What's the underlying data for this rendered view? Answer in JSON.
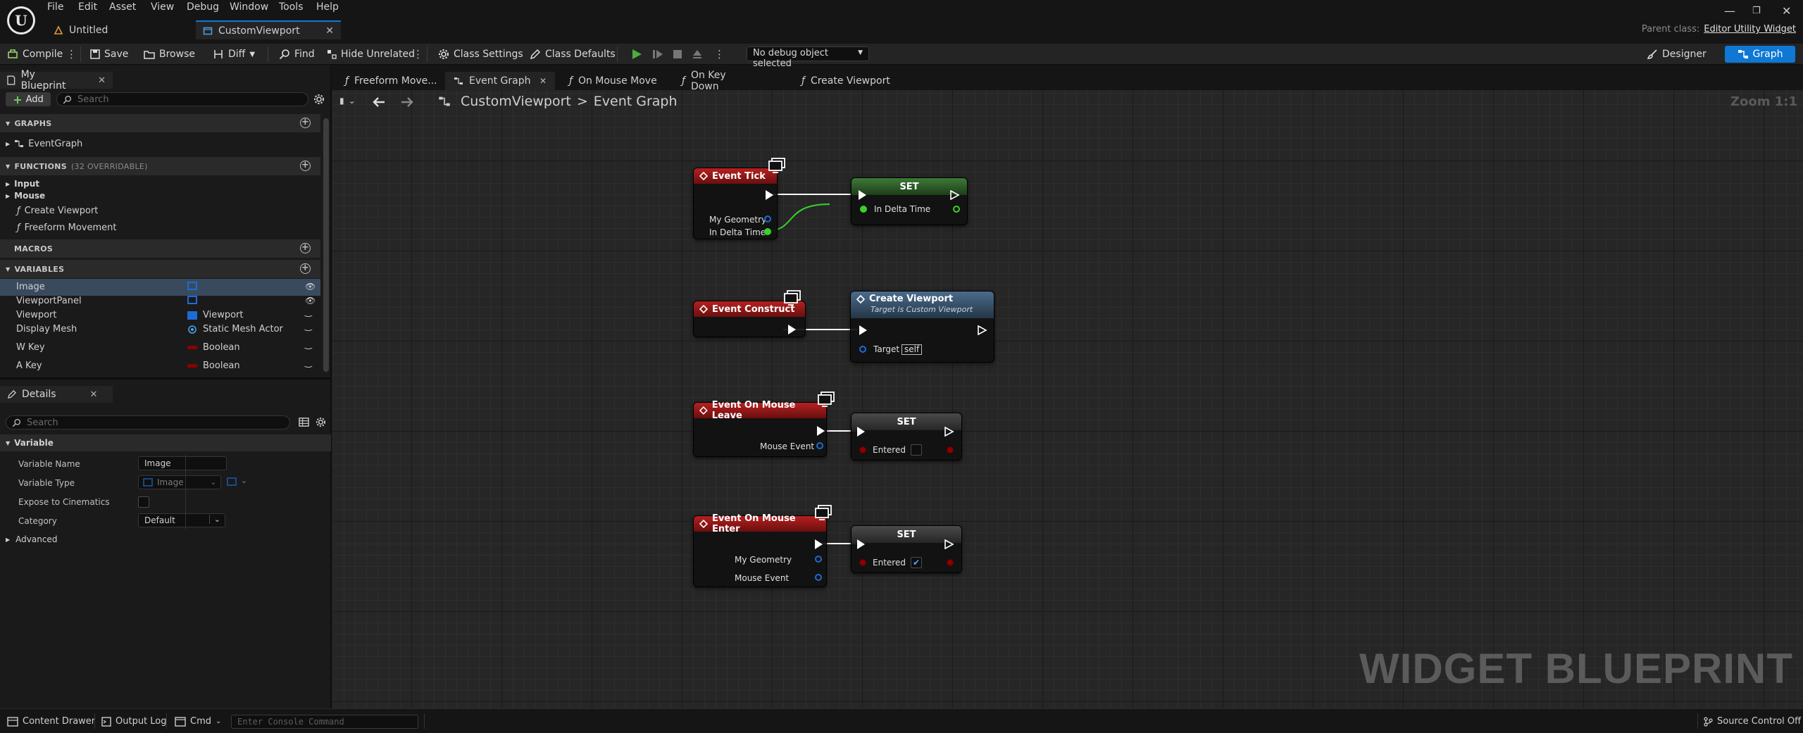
{
  "menu": [
    "File",
    "Edit",
    "Asset",
    "View",
    "Debug",
    "Window",
    "Tools",
    "Help"
  ],
  "doc_tabs": [
    {
      "label": "Untitled"
    },
    {
      "label": "CustomViewport"
    }
  ],
  "parent_class": {
    "label": "Parent class:",
    "value": "Editor Utility Widget"
  },
  "toolbar": {
    "compile": "Compile",
    "save": "Save",
    "browse": "Browse",
    "diff": "Diff",
    "find": "Find",
    "hide_unrelated": "Hide Unrelated",
    "class_settings": "Class Settings",
    "class_defaults": "Class Defaults",
    "debug_object": "No debug object selected",
    "designer": "Designer",
    "graph": "Graph"
  },
  "my_blueprint": {
    "tab": "My Blueprint",
    "add": "Add",
    "search_placeholder": "Search",
    "graphs_header": "GRAPHS",
    "graph_item": "EventGraph",
    "functions_header": "FUNCTIONS",
    "functions_sub": "(32 OVERRIDABLE)",
    "functions": [
      "Input",
      "Mouse",
      "Create Viewport",
      "Freeform Movement"
    ],
    "macros_header": "MACROS",
    "variables_header": "VARIABLES",
    "variables": [
      {
        "name": "Image",
        "type": ""
      },
      {
        "name": "ViewportPanel",
        "type": ""
      },
      {
        "name": "Viewport",
        "type": "Viewport"
      },
      {
        "name": "Display Mesh",
        "type": "Static Mesh Actor"
      },
      {
        "name": "W Key",
        "type": "Boolean"
      },
      {
        "name": "A Key",
        "type": "Boolean"
      }
    ]
  },
  "details": {
    "tab": "Details",
    "search_placeholder": "Search",
    "section": "Variable",
    "variable_name_label": "Variable Name",
    "variable_name_value": "Image",
    "variable_type_label": "Variable Type",
    "variable_type_value": "Image",
    "expose_label": "Expose to Cinematics",
    "category_label": "Category",
    "category_value": "Default",
    "advanced": "Advanced"
  },
  "graph_tabs": [
    "Freeform Move...",
    "Event Graph",
    "On Mouse Move",
    "On Key Down",
    "Create Viewport"
  ],
  "breadcrumb": {
    "root": "CustomViewport",
    "sep": ">",
    "current": "Event Graph"
  },
  "zoom": "Zoom 1:1",
  "watermark": "WIDGET BLUEPRINT",
  "nodes": {
    "event_tick": {
      "title": "Event Tick",
      "pins": [
        "My Geometry",
        "In Delta Time"
      ]
    },
    "set_tick": {
      "title": "SET",
      "pin": "In Delta Time"
    },
    "event_construct": {
      "title": "Event Construct"
    },
    "create_viewport": {
      "title": "Create Viewport",
      "subtitle": "Target is Custom Viewport",
      "pin": "Target",
      "pin_value": "self"
    },
    "mouse_leave": {
      "title": "Event On Mouse Leave",
      "pin": "Mouse Event"
    },
    "set_leave": {
      "title": "SET",
      "pin": "Entered",
      "checked": false
    },
    "mouse_enter": {
      "title": "Event On Mouse Enter",
      "pins": [
        "My Geometry",
        "Mouse Event"
      ]
    },
    "set_enter": {
      "title": "SET",
      "pin": "Entered",
      "checked": true
    }
  },
  "statusbar": {
    "content_drawer": "Content Drawer",
    "output_log": "Output Log",
    "cmd": "Cmd",
    "console_placeholder": "Enter Console Command",
    "source_control": "Source Control Off"
  }
}
